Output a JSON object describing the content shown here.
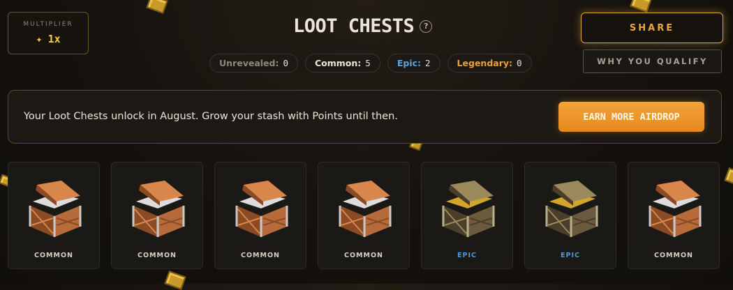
{
  "multiplier": {
    "label": "MULTIPLIER",
    "value": "1x"
  },
  "header": {
    "title": "LOOT CHESTS"
  },
  "counts": [
    {
      "label": "Unrevealed:",
      "value": "0",
      "color": "#8e887a"
    },
    {
      "label": "Common:",
      "value": "5",
      "color": "#ece6da"
    },
    {
      "label": "Epic:",
      "value": "2",
      "color": "#5aa2e0"
    },
    {
      "label": "Legendary:",
      "value": "0",
      "color": "#e8a13a"
    }
  ],
  "actions": {
    "share_label": "SHARE",
    "qualify_label": "WHY YOU QUALIFY"
  },
  "banner": {
    "message": "Your Loot Chests unlock in August. Grow your stash with Points until then.",
    "button_label": "EARN MORE AIRDROP"
  },
  "chests": [
    {
      "rarity": "COMMON",
      "color": "#d7d0c3"
    },
    {
      "rarity": "COMMON",
      "color": "#d7d0c3"
    },
    {
      "rarity": "COMMON",
      "color": "#d7d0c3"
    },
    {
      "rarity": "COMMON",
      "color": "#d7d0c3"
    },
    {
      "rarity": "EPIC",
      "color": "#4f97d8"
    },
    {
      "rarity": "EPIC",
      "color": "#4f97d8"
    },
    {
      "rarity": "COMMON",
      "color": "#d7d0c3"
    }
  ]
}
